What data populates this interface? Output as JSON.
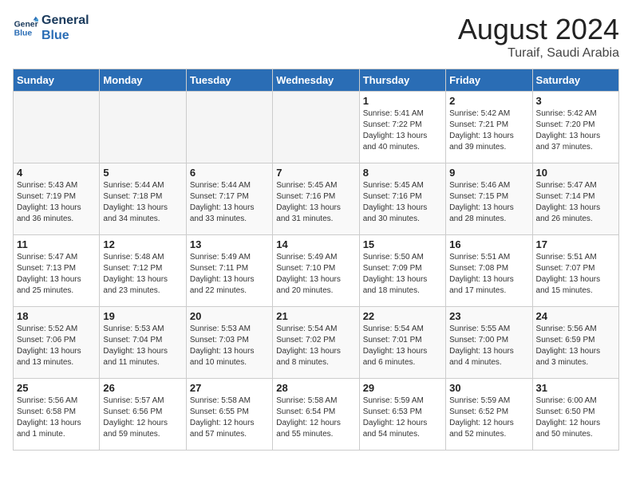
{
  "header": {
    "logo_line1": "General",
    "logo_line2": "Blue",
    "month_year": "August 2024",
    "location": "Turaif, Saudi Arabia"
  },
  "days_of_week": [
    "Sunday",
    "Monday",
    "Tuesday",
    "Wednesday",
    "Thursday",
    "Friday",
    "Saturday"
  ],
  "weeks": [
    [
      {
        "day": "",
        "info": ""
      },
      {
        "day": "",
        "info": ""
      },
      {
        "day": "",
        "info": ""
      },
      {
        "day": "",
        "info": ""
      },
      {
        "day": "1",
        "info": "Sunrise: 5:41 AM\nSunset: 7:22 PM\nDaylight: 13 hours\nand 40 minutes."
      },
      {
        "day": "2",
        "info": "Sunrise: 5:42 AM\nSunset: 7:21 PM\nDaylight: 13 hours\nand 39 minutes."
      },
      {
        "day": "3",
        "info": "Sunrise: 5:42 AM\nSunset: 7:20 PM\nDaylight: 13 hours\nand 37 minutes."
      }
    ],
    [
      {
        "day": "4",
        "info": "Sunrise: 5:43 AM\nSunset: 7:19 PM\nDaylight: 13 hours\nand 36 minutes."
      },
      {
        "day": "5",
        "info": "Sunrise: 5:44 AM\nSunset: 7:18 PM\nDaylight: 13 hours\nand 34 minutes."
      },
      {
        "day": "6",
        "info": "Sunrise: 5:44 AM\nSunset: 7:17 PM\nDaylight: 13 hours\nand 33 minutes."
      },
      {
        "day": "7",
        "info": "Sunrise: 5:45 AM\nSunset: 7:16 PM\nDaylight: 13 hours\nand 31 minutes."
      },
      {
        "day": "8",
        "info": "Sunrise: 5:45 AM\nSunset: 7:16 PM\nDaylight: 13 hours\nand 30 minutes."
      },
      {
        "day": "9",
        "info": "Sunrise: 5:46 AM\nSunset: 7:15 PM\nDaylight: 13 hours\nand 28 minutes."
      },
      {
        "day": "10",
        "info": "Sunrise: 5:47 AM\nSunset: 7:14 PM\nDaylight: 13 hours\nand 26 minutes."
      }
    ],
    [
      {
        "day": "11",
        "info": "Sunrise: 5:47 AM\nSunset: 7:13 PM\nDaylight: 13 hours\nand 25 minutes."
      },
      {
        "day": "12",
        "info": "Sunrise: 5:48 AM\nSunset: 7:12 PM\nDaylight: 13 hours\nand 23 minutes."
      },
      {
        "day": "13",
        "info": "Sunrise: 5:49 AM\nSunset: 7:11 PM\nDaylight: 13 hours\nand 22 minutes."
      },
      {
        "day": "14",
        "info": "Sunrise: 5:49 AM\nSunset: 7:10 PM\nDaylight: 13 hours\nand 20 minutes."
      },
      {
        "day": "15",
        "info": "Sunrise: 5:50 AM\nSunset: 7:09 PM\nDaylight: 13 hours\nand 18 minutes."
      },
      {
        "day": "16",
        "info": "Sunrise: 5:51 AM\nSunset: 7:08 PM\nDaylight: 13 hours\nand 17 minutes."
      },
      {
        "day": "17",
        "info": "Sunrise: 5:51 AM\nSunset: 7:07 PM\nDaylight: 13 hours\nand 15 minutes."
      }
    ],
    [
      {
        "day": "18",
        "info": "Sunrise: 5:52 AM\nSunset: 7:06 PM\nDaylight: 13 hours\nand 13 minutes."
      },
      {
        "day": "19",
        "info": "Sunrise: 5:53 AM\nSunset: 7:04 PM\nDaylight: 13 hours\nand 11 minutes."
      },
      {
        "day": "20",
        "info": "Sunrise: 5:53 AM\nSunset: 7:03 PM\nDaylight: 13 hours\nand 10 minutes."
      },
      {
        "day": "21",
        "info": "Sunrise: 5:54 AM\nSunset: 7:02 PM\nDaylight: 13 hours\nand 8 minutes."
      },
      {
        "day": "22",
        "info": "Sunrise: 5:54 AM\nSunset: 7:01 PM\nDaylight: 13 hours\nand 6 minutes."
      },
      {
        "day": "23",
        "info": "Sunrise: 5:55 AM\nSunset: 7:00 PM\nDaylight: 13 hours\nand 4 minutes."
      },
      {
        "day": "24",
        "info": "Sunrise: 5:56 AM\nSunset: 6:59 PM\nDaylight: 13 hours\nand 3 minutes."
      }
    ],
    [
      {
        "day": "25",
        "info": "Sunrise: 5:56 AM\nSunset: 6:58 PM\nDaylight: 13 hours\nand 1 minute."
      },
      {
        "day": "26",
        "info": "Sunrise: 5:57 AM\nSunset: 6:56 PM\nDaylight: 12 hours\nand 59 minutes."
      },
      {
        "day": "27",
        "info": "Sunrise: 5:58 AM\nSunset: 6:55 PM\nDaylight: 12 hours\nand 57 minutes."
      },
      {
        "day": "28",
        "info": "Sunrise: 5:58 AM\nSunset: 6:54 PM\nDaylight: 12 hours\nand 55 minutes."
      },
      {
        "day": "29",
        "info": "Sunrise: 5:59 AM\nSunset: 6:53 PM\nDaylight: 12 hours\nand 54 minutes."
      },
      {
        "day": "30",
        "info": "Sunrise: 5:59 AM\nSunset: 6:52 PM\nDaylight: 12 hours\nand 52 minutes."
      },
      {
        "day": "31",
        "info": "Sunrise: 6:00 AM\nSunset: 6:50 PM\nDaylight: 12 hours\nand 50 minutes."
      }
    ]
  ]
}
